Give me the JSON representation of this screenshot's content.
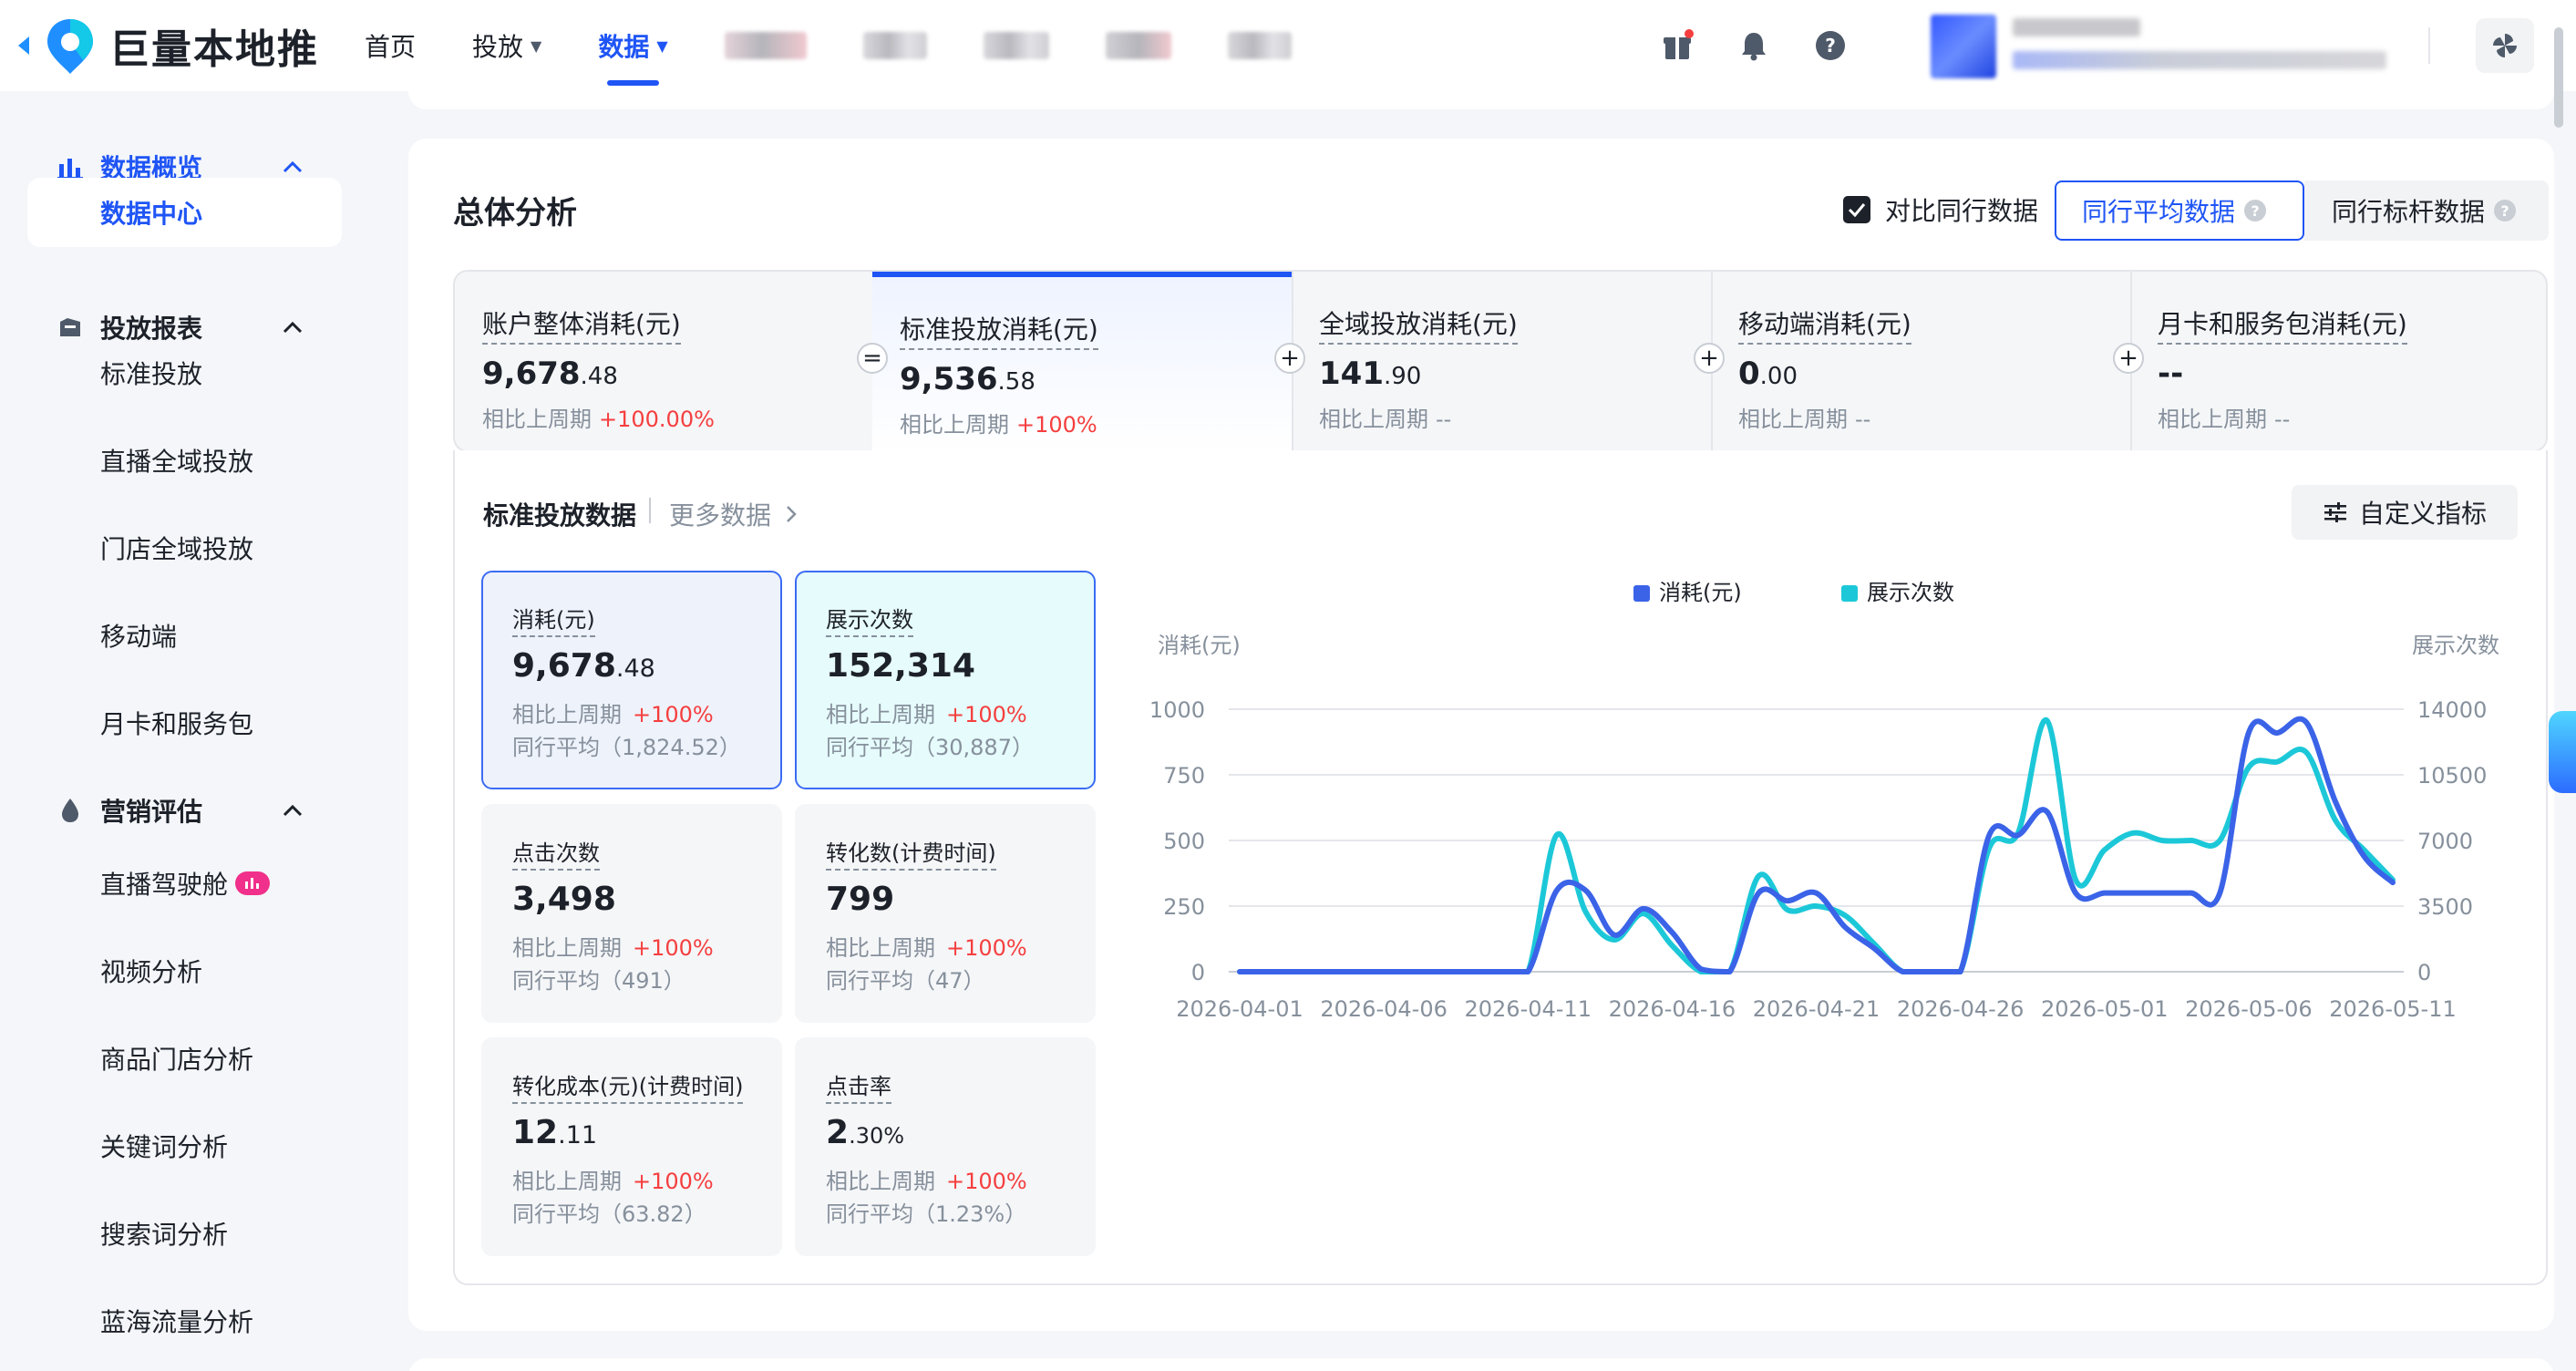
{
  "brand": {
    "name": "巨量本地推",
    "logo_icon": "location-pin-logo-icon"
  },
  "nav": {
    "items": [
      {
        "label": "首页",
        "caret": ""
      },
      {
        "label": "投放",
        "caret": "▼"
      },
      {
        "label": "数据",
        "caret": "▼"
      }
    ],
    "active_index": 2
  },
  "sidebar": {
    "groups": [
      {
        "label": "数据概览",
        "icon": "bar-chart-icon",
        "expanded": true
      },
      {
        "label": "投放报表",
        "icon": "report-icon",
        "expanded": true
      },
      {
        "label": "营销评估",
        "icon": "drop-icon",
        "expanded": true
      }
    ],
    "items": [
      {
        "label": "数据中心",
        "active": true
      },
      {
        "label": "标准投放"
      },
      {
        "label": "直播全域投放"
      },
      {
        "label": "门店全域投放"
      },
      {
        "label": "移动端"
      },
      {
        "label": "月卡和服务包"
      },
      {
        "label": "直播驾驶舱",
        "badge_icon": "live-bars-icon"
      },
      {
        "label": "视频分析"
      },
      {
        "label": "商品门店分析"
      },
      {
        "label": "关键词分析"
      },
      {
        "label": "搜索词分析"
      },
      {
        "label": "蓝海流量分析"
      }
    ]
  },
  "overview": {
    "title": "总体分析",
    "compare_label": "对比同行数据",
    "compare_checked": true,
    "benchmark_tabs": [
      "同行平均数据",
      "同行标杆数据"
    ],
    "active_benchmark": 0
  },
  "spend_tiles": [
    {
      "title": "账户整体消耗(元)",
      "int": "9,678",
      "dec": ".48",
      "cmp_label": "相比上周期",
      "cmp": "+100.00%",
      "cmp_state": "up"
    },
    {
      "title": "标准投放消耗(元)",
      "int": "9,536",
      "dec": ".58",
      "cmp_label": "相比上周期",
      "cmp": "+100%",
      "cmp_state": "up",
      "operator": "="
    },
    {
      "title": "全域投放消耗(元)",
      "int": "141",
      "dec": ".90",
      "cmp_label": "相比上周期",
      "cmp": "--",
      "cmp_state": "flat",
      "operator": "+"
    },
    {
      "title": "移动端消耗(元)",
      "int": "0",
      "dec": ".00",
      "cmp_label": "相比上周期",
      "cmp": "--",
      "cmp_state": "flat",
      "operator": "+"
    },
    {
      "title": "月卡和服务包消耗(元)",
      "int": "--",
      "dec": "",
      "cmp_label": "相比上周期",
      "cmp": "--",
      "cmp_state": "flat",
      "operator": "+"
    }
  ],
  "active_tile": 1,
  "section": {
    "title": "标准投放数据",
    "more_label": "更多数据",
    "custom_label": "自定义指标"
  },
  "metrics": [
    {
      "title": "消耗(元)",
      "int": "9,678",
      "dec": ".48",
      "cmp_label": "相比上周期",
      "cmp": "+100%",
      "avg": "同行平均（1,824.52）",
      "state": "selected-blue"
    },
    {
      "title": "展示次数",
      "int": "152,314",
      "dec": "",
      "cmp_label": "相比上周期",
      "cmp": "+100%",
      "avg": "同行平均（30,887）",
      "state": "selected-cyan"
    },
    {
      "title": "点击次数",
      "int": "3,498",
      "dec": "",
      "cmp_label": "相比上周期",
      "cmp": "+100%",
      "avg": "同行平均（491）",
      "state": ""
    },
    {
      "title": "转化数(计费时间)",
      "int": "799",
      "dec": "",
      "cmp_label": "相比上周期",
      "cmp": "+100%",
      "avg": "同行平均（47）",
      "state": ""
    },
    {
      "title": "转化成本(元)(计费时间)",
      "int": "12",
      "dec": ".11",
      "cmp_label": "相比上周期",
      "cmp": "+100%",
      "avg": "同行平均（63.82）",
      "state": ""
    },
    {
      "title": "点击率",
      "int": "2",
      "dec": ".30%",
      "cmp_label": "相比上周期",
      "cmp": "+100%",
      "avg": "同行平均（1.23%）",
      "state": ""
    }
  ],
  "colors": {
    "primary": "#1f55f5",
    "spend_line": "#3b63e8",
    "impr_line": "#1cc8d8",
    "up": "#f53f3f"
  },
  "chart_data": {
    "type": "line",
    "legend_position": "top-center",
    "ylabel_left": "消耗(元)",
    "ylabel_right": "展示次数",
    "ylim_left": [
      0,
      1000
    ],
    "ylim_right": [
      0,
      14000
    ],
    "yticks_left": [
      0,
      250,
      500,
      750,
      1000
    ],
    "yticks_right": [
      0,
      3500,
      7000,
      10500,
      14000
    ],
    "x": [
      "2026-04-01",
      "2026-04-02",
      "2026-04-03",
      "2026-04-04",
      "2026-04-05",
      "2026-04-06",
      "2026-04-07",
      "2026-04-08",
      "2026-04-09",
      "2026-04-10",
      "2026-04-11",
      "2026-04-12",
      "2026-04-13",
      "2026-04-14",
      "2026-04-15",
      "2026-04-16",
      "2026-04-17",
      "2026-04-18",
      "2026-04-19",
      "2026-04-20",
      "2026-04-21",
      "2026-04-22",
      "2026-04-23",
      "2026-04-24",
      "2026-04-25",
      "2026-04-26",
      "2026-04-27",
      "2026-04-28",
      "2026-04-29",
      "2026-04-30",
      "2026-05-01",
      "2026-05-02",
      "2026-05-03",
      "2026-05-04",
      "2026-05-05",
      "2026-05-06",
      "2026-05-07",
      "2026-05-08",
      "2026-05-09",
      "2026-05-10",
      "2026-05-11"
    ],
    "xtick_labels": [
      "2026-04-01",
      "2026-04-06",
      "2026-04-11",
      "2026-04-16",
      "2026-04-21",
      "2026-04-26",
      "2026-05-01",
      "2026-05-06",
      "2026-05-11"
    ],
    "series": [
      {
        "name": "消耗(元)",
        "axis": "left",
        "color": "#3b63e8",
        "values": [
          0,
          0,
          0,
          0,
          0,
          0,
          0,
          0,
          0,
          0,
          0,
          310,
          310,
          140,
          240,
          150,
          10,
          0,
          300,
          270,
          300,
          170,
          90,
          0,
          0,
          0,
          520,
          520,
          610,
          300,
          300,
          300,
          300,
          300,
          300,
          910,
          910,
          950,
          650,
          440,
          340
        ]
      },
      {
        "name": "展示次数",
        "axis": "right",
        "color": "#1cc8d8",
        "values": [
          0,
          0,
          0,
          0,
          0,
          0,
          0,
          0,
          0,
          0,
          0,
          7300,
          3200,
          1700,
          3100,
          1400,
          0,
          0,
          5100,
          3300,
          3500,
          3000,
          1500,
          0,
          0,
          0,
          6600,
          7400,
          13400,
          4900,
          6500,
          7400,
          7000,
          7000,
          7000,
          10900,
          11200,
          11700,
          8100,
          6500,
          4900
        ]
      }
    ]
  }
}
